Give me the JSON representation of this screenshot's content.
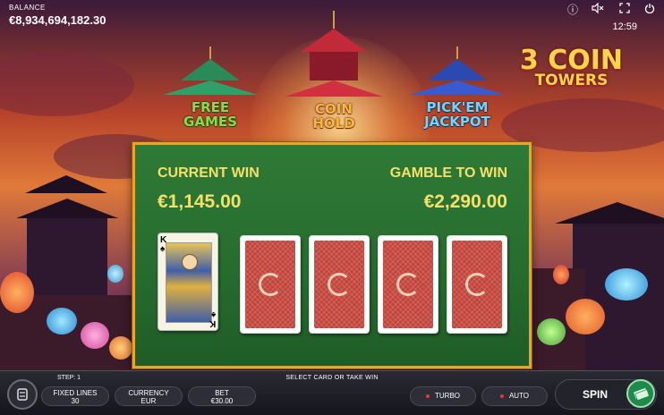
{
  "hud": {
    "balance_label": "BALANCE",
    "balance_value": "€8,934,694,182.30",
    "clock": "12:59",
    "icons": [
      "info-icon",
      "sound-muted-icon",
      "fullscreen-icon",
      "power-icon"
    ]
  },
  "logo": {
    "line1": "3 COIN",
    "line2": "TOWERS"
  },
  "towers": [
    {
      "line1": "FREE",
      "line2": "GAMES",
      "color": "#7fe04a"
    },
    {
      "line1": "COIN",
      "line2": "HOLD",
      "color": "#ffb43a"
    },
    {
      "line1": "PICK'EM",
      "line2": "JACKPOT",
      "color": "#6ad8ff"
    }
  ],
  "gamble": {
    "current_win_label": "CURRENT WIN",
    "current_win_value": "€1,145.00",
    "gamble_label": "GAMBLE TO WIN",
    "gamble_value": "€2,290.00",
    "dealer_card": {
      "rank": "K",
      "suit": "♠"
    },
    "card_backs": 4
  },
  "bottom": {
    "step": "STEP: 1",
    "message": "SELECT CARD OR TAKE WIN",
    "fixed_lines_label": "FIXED LINES",
    "fixed_lines_value": "30",
    "currency_label": "CURRENCY",
    "currency_value": "EUR",
    "bet_label": "BET",
    "bet_value": "€30.00",
    "turbo_label": "TURBO",
    "auto_label": "AUTO",
    "spin_label": "SPIN"
  },
  "colors": {
    "panel_border": "#e8a627",
    "panel_bg": "#2f7a36",
    "panel_text": "#f5e06a"
  }
}
